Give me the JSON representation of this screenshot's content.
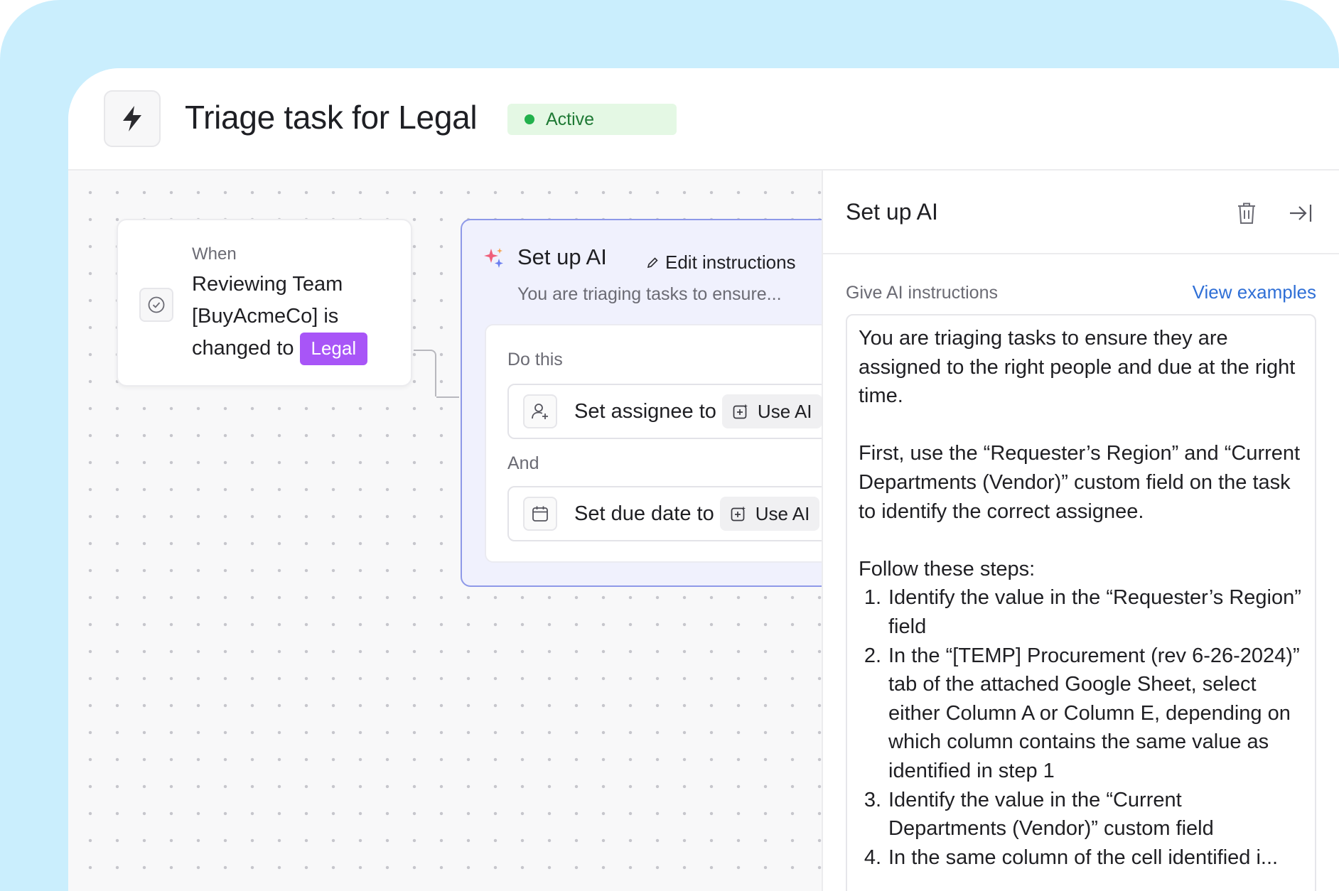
{
  "header": {
    "title": "Triage task for Legal",
    "status": "Active",
    "icon": "lightning-icon"
  },
  "trigger": {
    "when_label": "When",
    "text": "Reviewing Team [BuyAcmeCo] is changed to",
    "tag": "Legal",
    "tag_color": "#a855f7"
  },
  "ai_node": {
    "title": "Set up AI",
    "edit_label": "Edit instructions",
    "subtitle": "You are triaging tasks to ensure...",
    "do_label": "Do this",
    "and_label": "And",
    "actions": [
      {
        "label": "Set assignee to",
        "chip": "Use AI",
        "icon": "user-plus-icon"
      },
      {
        "label": "Set due date to",
        "chip": "Use AI",
        "icon": "calendar-icon"
      }
    ]
  },
  "panel": {
    "title": "Set up AI",
    "instructions_label": "Give AI instructions",
    "view_examples": "View examples",
    "para1": "You are triaging tasks to ensure they are assigned to the right people and due at the right time.",
    "para2": "First, use the “Requester’s Region” and “Current Departments (Vendor)” custom field on the task to identify the correct assignee.",
    "steps_intro": "Follow these steps:",
    "steps": [
      {
        "num": "1.",
        "text": "Identify the value in the “Requester’s Region” field"
      },
      {
        "num": "2.",
        "text": "In the “[TEMP] Procurement (rev 6-26-2024)” tab of the attached Google Sheet, select either Column A or Column E, depending on which column contains the same value as identified in step 1"
      },
      {
        "num": "3.",
        "text": "Identify the value in the “Current Departments (Vendor)” custom field"
      },
      {
        "num": "4.",
        "text": "In the same column of the cell identified i..."
      }
    ]
  },
  "colors": {
    "frame_bg": "#caeefd",
    "accent_blue": "#2f6fd6",
    "ai_card_border": "#8e99e8",
    "status_green": "#22b14c"
  }
}
